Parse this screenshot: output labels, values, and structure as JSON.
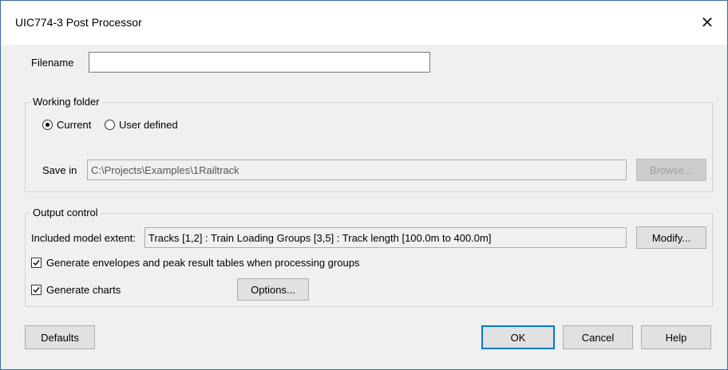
{
  "window": {
    "title": "UIC774-3 Post Processor"
  },
  "filename": {
    "label": "Filename",
    "value": ""
  },
  "working_folder": {
    "legend": "Working folder",
    "options": [
      {
        "label": "Current",
        "selected": true
      },
      {
        "label": "User defined",
        "selected": false
      }
    ],
    "save_in_label": "Save in",
    "save_in_value": "C:\\Projects\\Examples\\1Railtrack",
    "browse_label": "Browse..."
  },
  "output_control": {
    "legend": "Output control",
    "extent_label": "Included model extent:",
    "extent_value": "Tracks [1,2] : Train Loading Groups [3,5] : Track length [100.0m to 400.0m]",
    "modify_label": "Modify...",
    "envelopes_label": "Generate envelopes and peak result tables when processing groups",
    "envelopes_checked": true,
    "charts_label": "Generate charts",
    "charts_checked": true,
    "options_label": "Options..."
  },
  "footer": {
    "defaults_label": "Defaults",
    "ok_label": "OK",
    "cancel_label": "Cancel",
    "help_label": "Help"
  }
}
